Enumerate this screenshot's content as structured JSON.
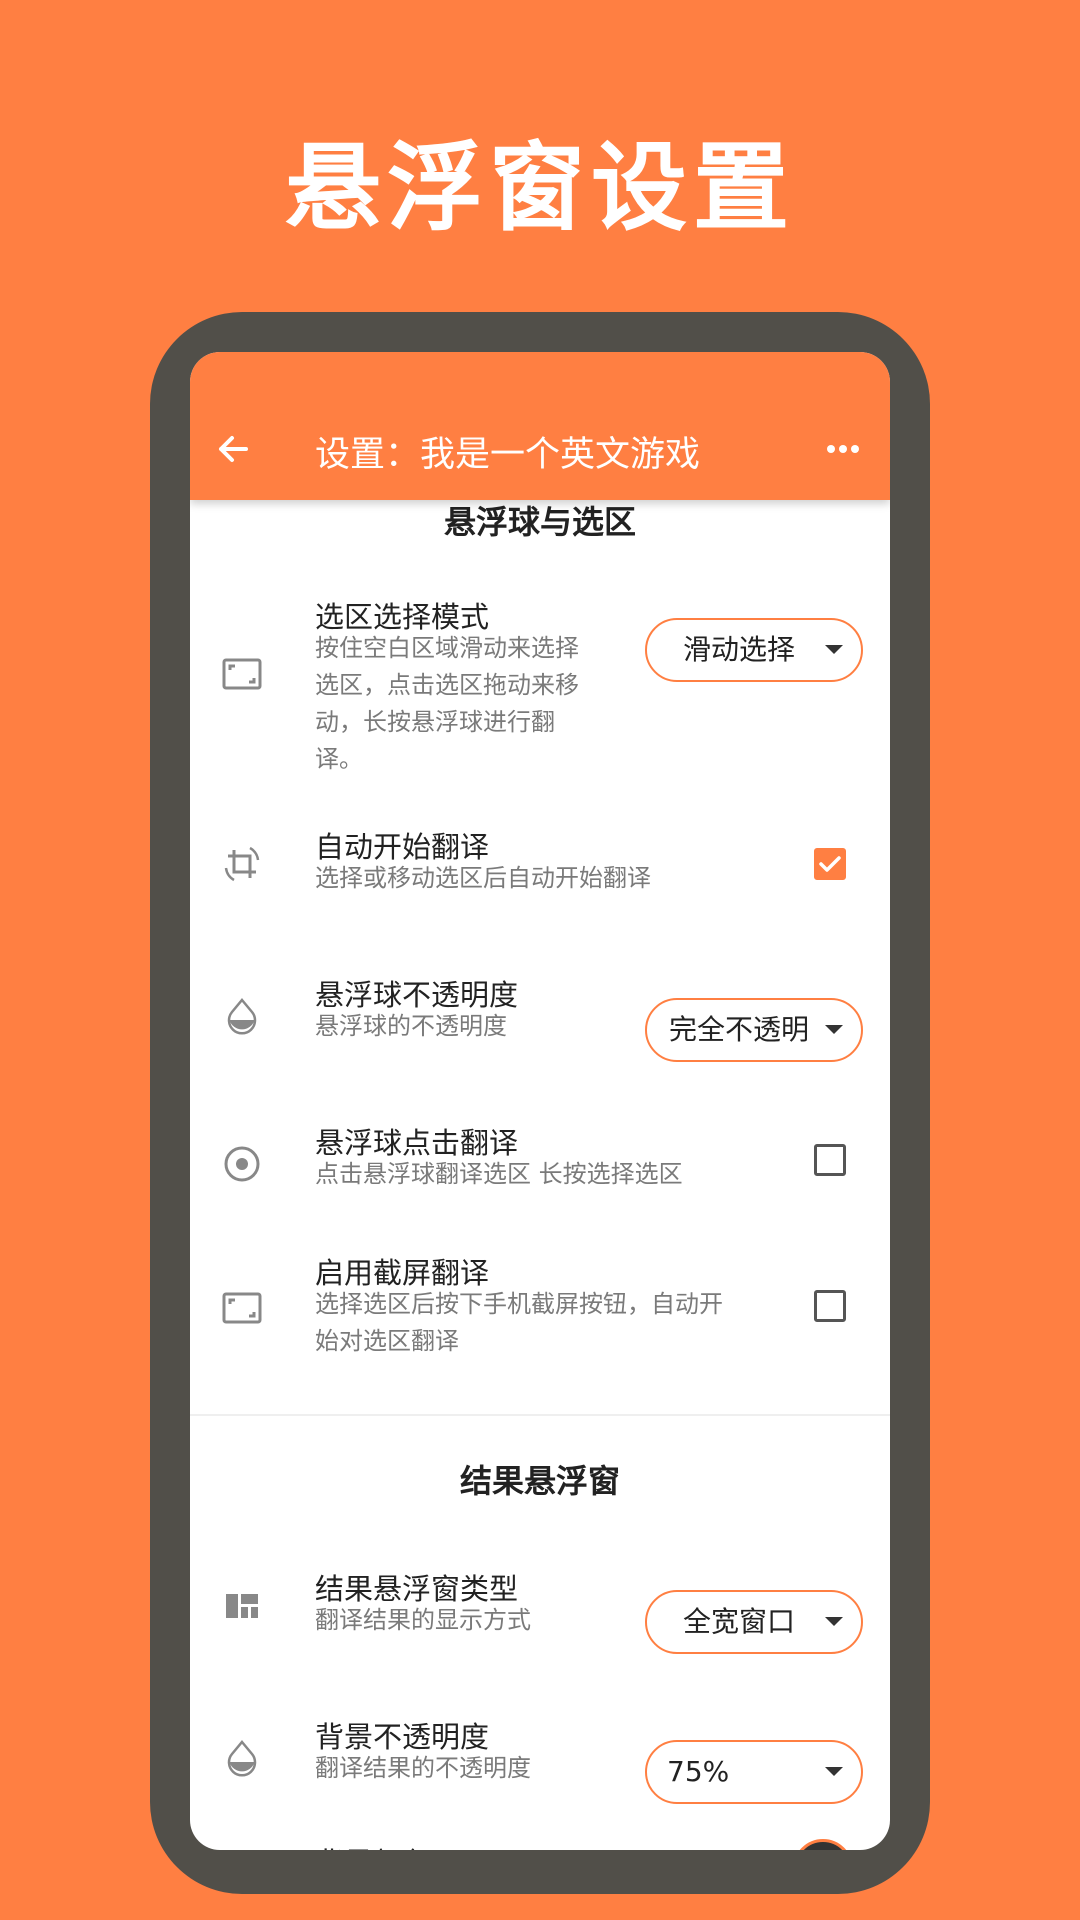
{
  "promo": {
    "title": "悬浮窗设置"
  },
  "appbar": {
    "title": "设置：我是一个英文游戏",
    "back_icon": "arrow-back-icon",
    "more_icon": "more-horiz-icon"
  },
  "accent_color": "#FF7F42",
  "frame_color": "#514F49",
  "sections": {
    "float_ball": {
      "title": "悬浮球与选区",
      "items": {
        "select_mode": {
          "title": "选区选择模式",
          "subtitle_lines": [
            "按住空白区域滑动来选择",
            "选区，点击选区拖动来移",
            "动，长按悬浮球进行翻",
            "译。"
          ],
          "value": "滑动选择",
          "icon": "selection-frame-icon"
        },
        "auto_translate": {
          "title": "自动开始翻译",
          "subtitle": "选择或移动选区后自动开始翻译",
          "checked": true,
          "icon": "crop-rotate-icon"
        },
        "ball_opacity": {
          "title": "悬浮球不透明度",
          "subtitle": "悬浮球的不透明度",
          "value": "完全不透明",
          "icon": "opacity-drop-icon"
        },
        "ball_click": {
          "title": "悬浮球点击翻译",
          "subtitle": "点击悬浮球翻译选区 长按选择选区",
          "checked": false,
          "icon": "radio-target-icon"
        },
        "screenshot": {
          "title": "启用截屏翻译",
          "subtitle_lines": [
            "选择选区后按下手机截屏按钮，自动开",
            "始对选区翻译"
          ],
          "checked": false,
          "icon": "selection-frame-icon"
        }
      }
    },
    "result": {
      "title": "结果悬浮窗",
      "items": {
        "window_type": {
          "title": "结果悬浮窗类型",
          "subtitle": "翻译结果的显示方式",
          "value": "全宽窗口",
          "icon": "dashboard-icon"
        },
        "bg_opacity": {
          "title": "背景不透明度",
          "subtitle": "翻译结果的不透明度",
          "value": "75%",
          "icon": "opacity-drop-icon"
        },
        "bg_color": {
          "title": "背景颜色"
        }
      }
    }
  }
}
